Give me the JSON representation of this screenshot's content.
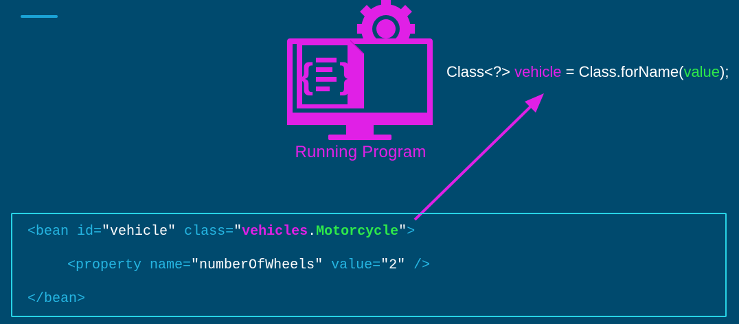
{
  "header": {
    "accent_color": "#1aa3d6"
  },
  "program": {
    "icon": "computer-gear-icon",
    "label": "Running Program",
    "color": "#e020e6"
  },
  "code": {
    "prefix": "Class<?> ",
    "var": "vehicle",
    "mid": " = Class.forName(",
    "arg": "value",
    "suffix": ");"
  },
  "xml": {
    "line1": {
      "open": "<bean ",
      "id_attr": "id=",
      "id_val": "\"vehicle\"",
      "space": " ",
      "class_attr": "class=",
      "quote_open": "\"",
      "pkg": "vehicles",
      "dot": ".",
      "cls": "Motorcycle",
      "quote_close": "\"",
      "close": ">"
    },
    "line2": {
      "open": "<property ",
      "name_attr": "name=",
      "name_val": "\"numberOfWheels\"",
      "space": " ",
      "value_attr": "value=",
      "value_val": "\"2\"",
      "close": " />"
    },
    "line3": {
      "close": "</bean>"
    }
  },
  "colors": {
    "pink": "#e020e6",
    "green": "#2ee84a",
    "cyan": "#27d3e6",
    "background": "#004a6e"
  }
}
